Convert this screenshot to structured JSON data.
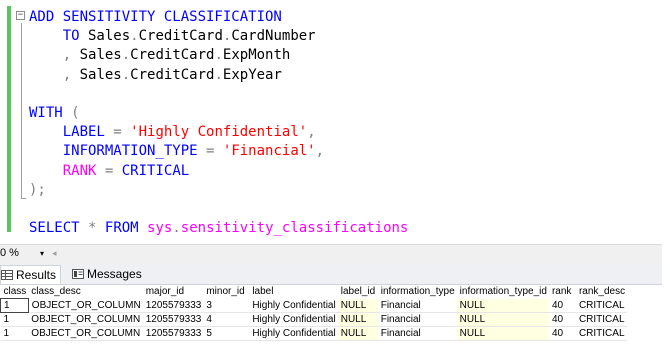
{
  "editor": {
    "fold_symbol": "−",
    "lines": [
      {
        "tokens": [
          {
            "t": "ADD SENSITIVITY CLASSIFICATION",
            "c": "kw"
          }
        ]
      },
      {
        "tokens": [
          {
            "t": "    "
          },
          {
            "t": "TO",
            "c": "kw"
          },
          {
            "t": " Sales"
          },
          {
            "t": ".",
            "c": "op"
          },
          {
            "t": "CreditCard"
          },
          {
            "t": ".",
            "c": "op"
          },
          {
            "t": "CardNumber"
          }
        ]
      },
      {
        "tokens": [
          {
            "t": "    "
          },
          {
            "t": ",",
            "c": "op"
          },
          {
            "t": " Sales"
          },
          {
            "t": ".",
            "c": "op"
          },
          {
            "t": "CreditCard"
          },
          {
            "t": ".",
            "c": "op"
          },
          {
            "t": "ExpMonth"
          }
        ]
      },
      {
        "tokens": [
          {
            "t": "    "
          },
          {
            "t": ",",
            "c": "op"
          },
          {
            "t": " Sales"
          },
          {
            "t": ".",
            "c": "op"
          },
          {
            "t": "CreditCard"
          },
          {
            "t": ".",
            "c": "op"
          },
          {
            "t": "ExpYear"
          }
        ]
      },
      {
        "tokens": []
      },
      {
        "tokens": [
          {
            "t": "WITH",
            "c": "kw"
          },
          {
            "t": " "
          },
          {
            "t": "(",
            "c": "op"
          }
        ]
      },
      {
        "tokens": [
          {
            "t": "    LABEL",
            "c": "kw"
          },
          {
            "t": " "
          },
          {
            "t": "=",
            "c": "op"
          },
          {
            "t": " "
          },
          {
            "t": "'Highly Confidential'",
            "c": "str"
          },
          {
            "t": ",",
            "c": "op"
          }
        ]
      },
      {
        "tokens": [
          {
            "t": "    INFORMATION_TYPE",
            "c": "kw"
          },
          {
            "t": " "
          },
          {
            "t": "=",
            "c": "op"
          },
          {
            "t": " "
          },
          {
            "t": "'Financial'",
            "c": "str"
          },
          {
            "t": ",",
            "c": "op"
          }
        ]
      },
      {
        "tokens": [
          {
            "t": "    RANK",
            "c": "fn"
          },
          {
            "t": " "
          },
          {
            "t": "=",
            "c": "op"
          },
          {
            "t": " "
          },
          {
            "t": "CRITICAL",
            "c": "kw"
          }
        ]
      },
      {
        "tokens": [
          {
            "t": ");",
            "c": "op"
          }
        ]
      },
      {
        "tokens": []
      },
      {
        "tokens": [
          {
            "t": "SELECT",
            "c": "kw"
          },
          {
            "t": " "
          },
          {
            "t": "*",
            "c": "op"
          },
          {
            "t": " "
          },
          {
            "t": "FROM",
            "c": "kw"
          },
          {
            "t": " "
          },
          {
            "t": "sys",
            "c": "fn"
          },
          {
            "t": ".",
            "c": "op"
          },
          {
            "t": "sensitivity_classifications",
            "c": "fn"
          }
        ]
      }
    ]
  },
  "status": {
    "zoom": "0 %",
    "zoom_dropdown": "▾",
    "scroll_left": "◂"
  },
  "tabs": {
    "results": "Results",
    "messages": "Messages"
  },
  "grid": {
    "columns": [
      "class",
      "class_desc",
      "major_id",
      "minor_id",
      "label",
      "label_id",
      "information_type",
      "information_type_id",
      "rank",
      "rank_desc"
    ],
    "rows": [
      [
        "1",
        "OBJECT_OR_COLUMN",
        "1205579333",
        "3",
        "Highly Confidential",
        "NULL",
        "Financial",
        "NULL",
        "40",
        "CRITICAL"
      ],
      [
        "1",
        "OBJECT_OR_COLUMN",
        "1205579333",
        "4",
        "Highly Confidential",
        "NULL",
        "Financial",
        "NULL",
        "40",
        "CRITICAL"
      ],
      [
        "1",
        "OBJECT_OR_COLUMN",
        "1205579333",
        "5",
        "Highly Confidential",
        "NULL",
        "Financial",
        "NULL",
        "40",
        "CRITICAL"
      ]
    ]
  },
  "colors": {
    "keyword": "#0000ff",
    "function": "#ff00ff",
    "string": "#ff0000",
    "operator": "#808080",
    "change_bar": "#5cc25c",
    "null_cell": "#ffffe1"
  }
}
